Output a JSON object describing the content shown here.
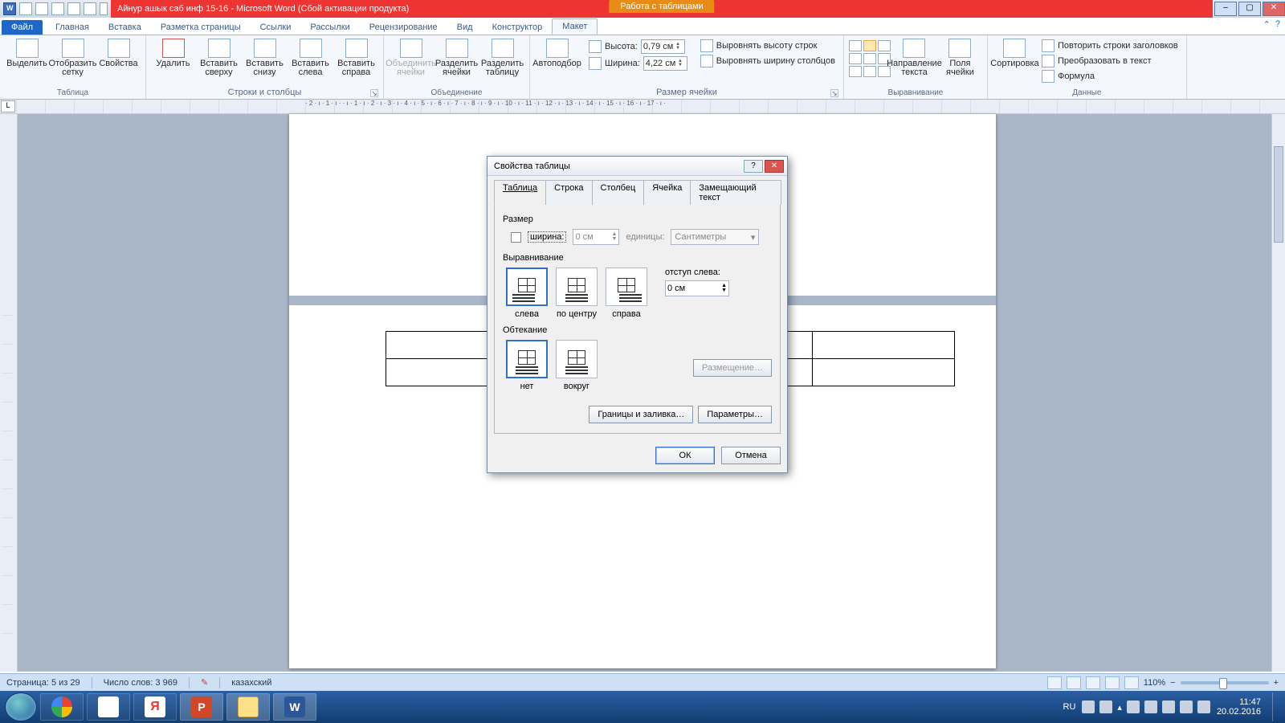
{
  "titlebar": {
    "document_title": "Айнур ашык саб инф 15-16  -  Microsoft Word (Сбой активации продукта)",
    "context_tab": "Работа с таблицами"
  },
  "ribbon_tabs": {
    "file": "Файл",
    "home": "Главная",
    "insert": "Вставка",
    "pagelayout": "Разметка страницы",
    "references": "Ссылки",
    "mailings": "Рассылки",
    "review": "Рецензирование",
    "view": "Вид",
    "design": "Конструктор",
    "layout": "Макет"
  },
  "ribbon": {
    "table": {
      "select": "Выделить",
      "gridlines": "Отобразить\nсетку",
      "properties": "Свойства",
      "group": "Таблица"
    },
    "rowscols": {
      "delete": "Удалить",
      "above": "Вставить\nсверху",
      "below": "Вставить\nснизу",
      "left": "Вставить\nслева",
      "right": "Вставить\nсправа",
      "group": "Строки и столбцы"
    },
    "merge": {
      "merge": "Объединить\nячейки",
      "splitc": "Разделить\nячейки",
      "splitt": "Разделить\nтаблицу",
      "group": "Объединение"
    },
    "cellsize": {
      "autofit": "Автоподбор",
      "hlabel": "Высота:",
      "hval": "0,79 см",
      "wlabel": "Ширина:",
      "wval": "4,22 см",
      "dist_h": "Выровнять высоту строк",
      "dist_w": "Выровнять ширину столбцов",
      "group": "Размер ячейки"
    },
    "align": {
      "dir": "Направление\nтекста",
      "margins": "Поля\nячейки",
      "group": "Выравнивание"
    },
    "data": {
      "sort": "Сортировка",
      "repeat": "Повторить строки заголовков",
      "convert": "Преобразовать в текст",
      "formula": "Формула",
      "group": "Данные"
    }
  },
  "ruler_numbers": "· 2 · ı · 1 · ı ·  · ı · 1 · ı · 2 · ı · 3 · ı · 4 · ı · 5 · ı · 6 · ı · 7 · ı · 8 · ı · 9 · ı · 10 · ı · 11 · ı · 12 · ı · 13 · ı · 14 · ı · 15 · ı · 16 · ı · 17 · ı ·",
  "dialog": {
    "title": "Свойства таблицы",
    "tabs": {
      "table": "Таблица",
      "row": "Строка",
      "column": "Столбец",
      "cell": "Ячейка",
      "alt": "Замещающий текст"
    },
    "size_section": "Размер",
    "width_label": "ширина:",
    "width_value": "0 см",
    "units_label": "единицы:",
    "units_value": "Сантиметры",
    "align_section": "Выравнивание",
    "align": {
      "left": "слева",
      "center": "по центру",
      "right": "справа"
    },
    "indent_label": "отступ слева:",
    "indent_value": "0 см",
    "wrap_section": "Обтекание",
    "wrap": {
      "none": "нет",
      "around": "вокруг"
    },
    "positioning": "Размещение…",
    "borders": "Границы и заливка…",
    "options": "Параметры…",
    "ok": "ОК",
    "cancel": "Отмена"
  },
  "status": {
    "page": "Страница: 5 из 29",
    "words": "Число слов: 3 969",
    "lang": "казахский",
    "zoom": "110%"
  },
  "tray": {
    "lang": "RU",
    "time": "11:47",
    "date": "20.02.2016"
  }
}
